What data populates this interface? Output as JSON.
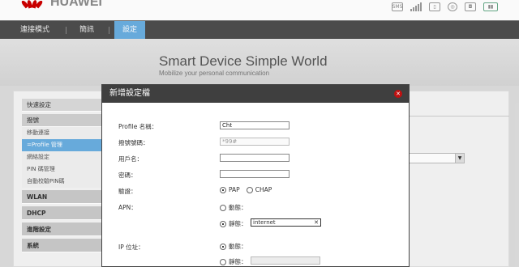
{
  "header": {
    "brand": "HUAWEI",
    "icons": [
      "sms-icon",
      "signal-icon",
      "sim-icon",
      "globe-icon",
      "wifi-icon",
      "battery-icon"
    ]
  },
  "nav": {
    "items": [
      {
        "label": "連接模式"
      },
      {
        "label": "簡訊"
      },
      {
        "label": "設定"
      }
    ]
  },
  "banner": {
    "slogan": "Smart Device  Simple World",
    "subslogan": "Mobilize your personal communication"
  },
  "sidebar": {
    "items": [
      {
        "label": "快速設定"
      },
      {
        "label": "撥號"
      },
      {
        "label": "移動連接"
      },
      {
        "label": "=Profile 管理"
      },
      {
        "label": "網絡設定"
      },
      {
        "label": "PIN 碼管理"
      },
      {
        "label": "自動校驗PIN碼"
      },
      {
        "label": "WLAN"
      },
      {
        "label": "DHCP"
      },
      {
        "label": "進階設定"
      },
      {
        "label": "系統"
      }
    ]
  },
  "dialog": {
    "title": "新增設定檔",
    "fields": {
      "profile_name_label": "Profile 名稱：",
      "profile_name_value": "Cht",
      "dial_number_label": "撥號號碼：",
      "dial_number_value": "*99#",
      "username_label": "用戶名：",
      "password_label": "密碼：",
      "auth_label": "驗證：",
      "auth_pap": "PAP",
      "auth_chap": "CHAP",
      "apn_label": "APN：",
      "apn_dynamic": "動態：",
      "apn_static": "靜態：",
      "apn_value": "internet",
      "ip_label": "IP 位址：",
      "ip_dynamic": "動態：",
      "ip_static": "靜態："
    }
  }
}
